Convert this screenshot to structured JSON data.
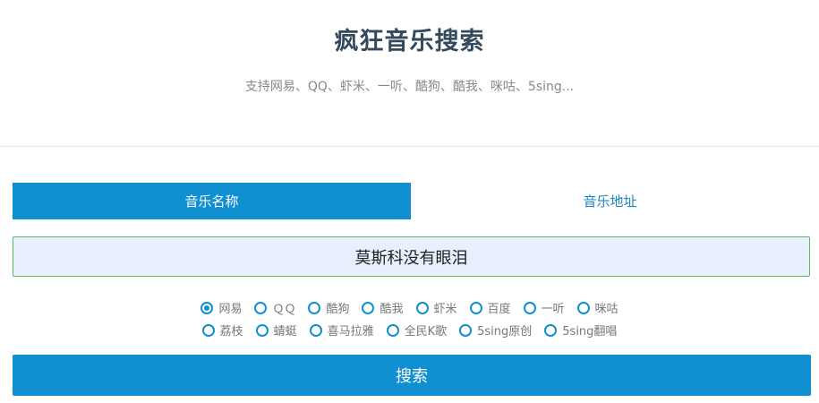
{
  "header": {
    "title": "疯狂音乐搜索",
    "subtitle": "支持网易、QQ、虾米、一听、酷狗、酷我、咪咕、5sing..."
  },
  "tabs": [
    {
      "label": "音乐名称",
      "active": true
    },
    {
      "label": "音乐地址",
      "active": false
    }
  ],
  "search": {
    "value": "莫斯科没有眼泪"
  },
  "sources": {
    "row1": [
      {
        "label": "网易",
        "checked": true
      },
      {
        "label": "ＱＱ",
        "checked": false
      },
      {
        "label": "酷狗",
        "checked": false
      },
      {
        "label": "酷我",
        "checked": false
      },
      {
        "label": "虾米",
        "checked": false
      },
      {
        "label": "百度",
        "checked": false
      },
      {
        "label": "一听",
        "checked": false
      },
      {
        "label": "咪咕",
        "checked": false
      }
    ],
    "row2": [
      {
        "label": "荔枝",
        "checked": false
      },
      {
        "label": "蜻蜓",
        "checked": false
      },
      {
        "label": "喜马拉雅",
        "checked": false
      },
      {
        "label": "全民K歌",
        "checked": false
      },
      {
        "label": "5sing原创",
        "checked": false
      },
      {
        "label": "5sing翻唱",
        "checked": false
      }
    ]
  },
  "button": {
    "label": "搜索"
  },
  "colors": {
    "accent": "#1190d1",
    "title": "#34495e",
    "input_border": "#5cb85c",
    "input_bg": "#e8f0fe"
  }
}
